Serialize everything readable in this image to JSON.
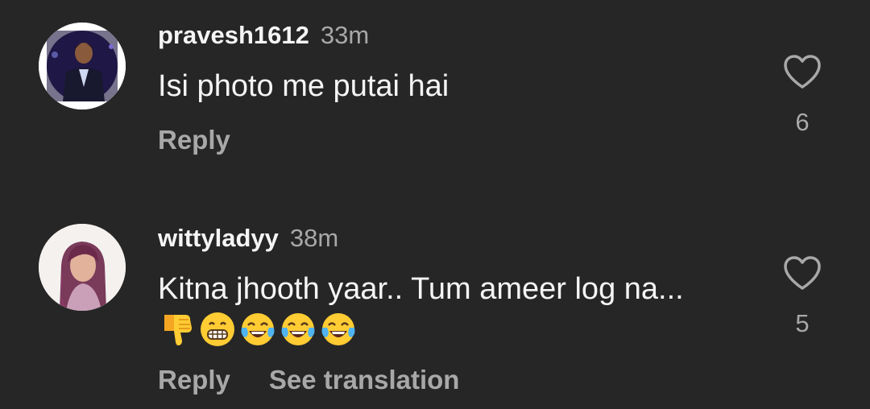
{
  "comments": [
    {
      "username": "pravesh1612",
      "time": "33m",
      "text": "Isi photo me putai hai",
      "reply_label": "Reply",
      "likes": "6"
    },
    {
      "username": "wittyladyy",
      "time": "38m",
      "text": "Kitna jhooth yaar.. Tum ameer log na...",
      "emojis": [
        "thumbs-down",
        "grinning-face",
        "face-with-tears-of-joy",
        "face-with-tears-of-joy",
        "face-with-tears-of-joy"
      ],
      "reply_label": "Reply",
      "translation_label": "See translation",
      "likes": "5"
    }
  ],
  "colors": {
    "background": "#262626",
    "primary_text": "#f5f5f5",
    "secondary_text": "#a8a8a8",
    "emoji_yellow": "#ffcc33"
  }
}
